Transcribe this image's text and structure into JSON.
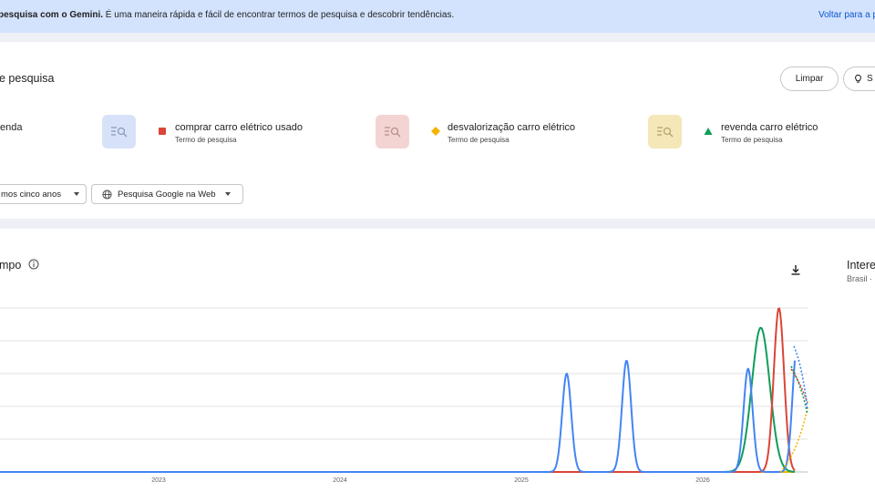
{
  "banner": {
    "bold": "pesquisa com o Gemini.",
    "text": " É uma maneira rápida e fácil de encontrar termos de pesquisa e descobrir tendências.",
    "link": "Voltar para a p"
  },
  "compare": {
    "title": "e pesquisa",
    "clear_label": "Limpar",
    "suggest_label": "S"
  },
  "terms": [
    {
      "label": "enda",
      "sub": "",
      "color": "#4285f4",
      "bg": "#e8f0fe"
    },
    {
      "label": "comprar carro elétrico usado",
      "sub": "Termo de pesquisa",
      "color": "#db4437",
      "bg": "#fce8e6"
    },
    {
      "label": "desvalorização carro elétrico",
      "sub": "Termo de pesquisa",
      "color": "#f4b400",
      "bg": "#fef7e0"
    },
    {
      "label": "revenda carro elétrico",
      "sub": "Termo de pesquisa",
      "color": "#0f9d58",
      "bg": "#e6f4ea"
    }
  ],
  "filters": {
    "time": "mos cinco anos",
    "source": "Pesquisa Google na Web"
  },
  "chart_section": {
    "title": "mpo",
    "side_title": "Intere",
    "side_sub": "Brasil ·"
  },
  "chart_data": {
    "type": "line",
    "x_ticks": [
      "2023",
      "2024",
      "2025",
      "2026"
    ],
    "grid": true,
    "series": [
      {
        "name": "",
        "color": "#4285f4",
        "peaks": [
          {
            "x": 2025.25,
            "y": 60
          },
          {
            "x": 2025.58,
            "y": 68
          },
          {
            "x": 2026.25,
            "y": 63
          },
          {
            "x": 2026.52,
            "y": 77
          }
        ]
      },
      {
        "name": "comprar carro elétrico usado",
        "color": "#db4437",
        "peaks": [
          {
            "x": 2026.42,
            "y": 100
          }
        ]
      },
      {
        "name": "desvalorização carro elétrico",
        "color": "#f4b400",
        "peaks": []
      },
      {
        "name": "revenda carro elétrico",
        "color": "#0f9d58",
        "peaks": [
          {
            "x": 2026.32,
            "y": 88
          }
        ]
      }
    ]
  }
}
